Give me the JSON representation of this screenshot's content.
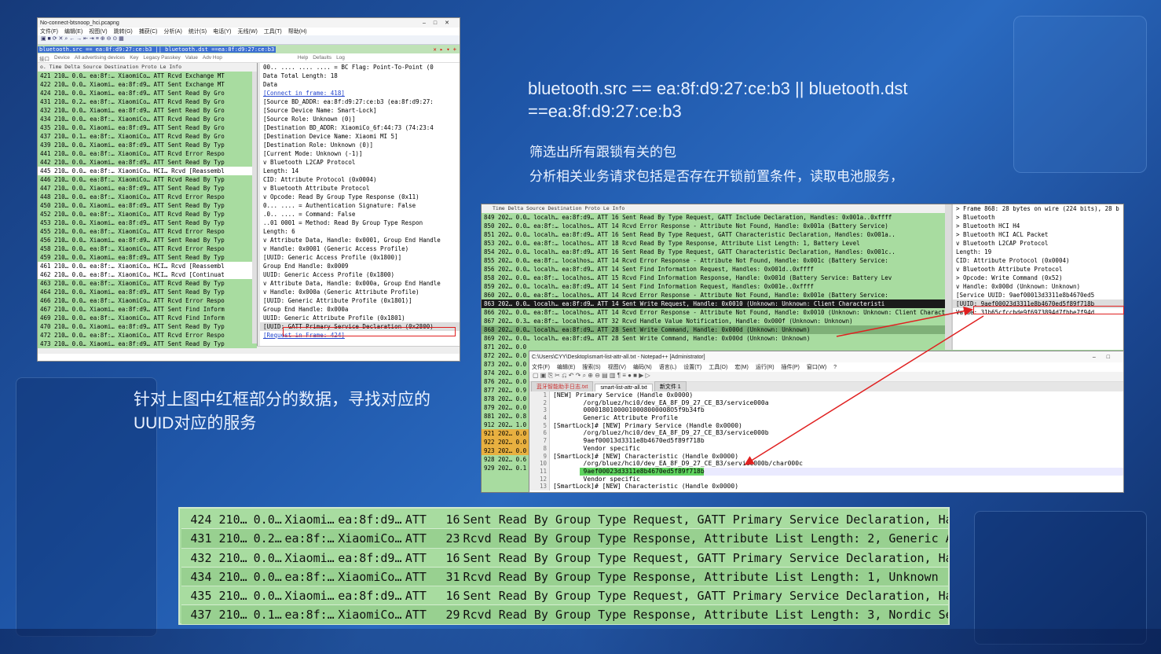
{
  "ws1": {
    "title": "No-connect-btsnoop_hci.pcapng",
    "menu": [
      "文件(F)",
      "编辑(E)",
      "视图(V)",
      "跳转(G)",
      "捕获(C)",
      "分析(A)",
      "统计(S)",
      "电话(Y)",
      "无线(W)",
      "工具(T)",
      "帮助(H)"
    ],
    "filter": "bluetooth.src == ea:8f:d9:27:ce:b3 || bluetooth.dst ==ea:8f:d9:27:ce:b3",
    "bar2": [
      "接口",
      "Device",
      "All advertising devices",
      "Key",
      "Legacy Passkey",
      "Value",
      "Adv Hop",
      "Help",
      "Defaults",
      "Log"
    ],
    "header": "o.    Time  Delta  Source     Destination  Proto Le Info",
    "rows": [
      {
        "t": " 421 210… 0.0… ea:8f:… XiaomiCo… ATT   Rcvd Exchange MT",
        "c": "g"
      },
      {
        "t": " 422 210… 0.0… Xiaomi… ea:8f:d9… ATT   Sent Exchange MT",
        "c": "g"
      },
      {
        "t": " 424 210… 0.0… Xiaomi… ea:8f:d9… ATT   Sent Read By Gro",
        "c": "g"
      },
      {
        "t": " 431 210… 0.2… ea:8f:… XiaomiCo… ATT   Rcvd Read By Gro",
        "c": "g"
      },
      {
        "t": " 432 210… 0.0… Xiaomi… ea:8f:d9… ATT   Sent Read By Gro",
        "c": "g"
      },
      {
        "t": " 434 210… 0.0… ea:8f:… XiaomiCo… ATT   Rcvd Read By Gro",
        "c": "g"
      },
      {
        "t": " 435 210… 0.0… Xiaomi… ea:8f:d9… ATT   Sent Read By Gro",
        "c": "g"
      },
      {
        "t": " 437 210… 0.1… ea:8f:… XiaomiCo… ATT   Rcvd Read By Gro",
        "c": "g"
      },
      {
        "t": " 439 210… 0.0… Xiaomi… ea:8f:d9… ATT   Sent Read By Typ",
        "c": "g"
      },
      {
        "t": " 441 210… 0.0… ea:8f:… XiaomiCo… ATT   Rcvd Error Respo",
        "c": "g"
      },
      {
        "t": " 442 210… 0.0… Xiaomi… ea:8f:d9… ATT   Sent Read By Typ",
        "c": "g"
      },
      {
        "t": " 445 210… 0.0… ea:8f:… XiaomiCo… HCI…  Rcvd [Reassembl",
        "c": "w"
      },
      {
        "t": " 446 210… 0.0… ea:8f:… XiaomiCo… ATT   Rcvd Read By Typ",
        "c": "g"
      },
      {
        "t": " 447 210… 0.0… Xiaomi… ea:8f:d9… ATT   Sent Read By Typ",
        "c": "g"
      },
      {
        "t": " 448 210… 0.0… ea:8f:… XiaomiCo… ATT   Rcvd Error Respo",
        "c": "g"
      },
      {
        "t": " 450 210… 0.0… Xiaomi… ea:8f:d9… ATT   Sent Read By Typ",
        "c": "g"
      },
      {
        "t": " 452 210… 0.0… ea:8f:… XiaomiCo… ATT   Rcvd Read By Typ",
        "c": "g"
      },
      {
        "t": " 453 210… 0.0… Xiaomi… ea:8f:d9… ATT   Sent Read By Typ",
        "c": "g"
      },
      {
        "t": " 455 210… 0.0… ea:8f:… XiaomiCo… ATT   Rcvd Error Respo",
        "c": "g"
      },
      {
        "t": " 456 210… 0.0… Xiaomi… ea:8f:d9… ATT   Sent Read By Typ",
        "c": "g"
      },
      {
        "t": " 458 210… 0.0… ea:8f:… XiaomiCo… ATT   Rcvd Error Respo",
        "c": "g"
      },
      {
        "t": " 459 210… 0.0… Xiaomi… ea:8f:d9… ATT   Sent Read By Typ",
        "c": "g"
      },
      {
        "t": " 461 210… 0.0… ea:8f:… XiaomiCo… HCI…  Rcvd [Reassembl",
        "c": "w"
      },
      {
        "t": " 462 210… 0.0… ea:8f:… XiaomiCo… HCI…  Rcvd [Continuat",
        "c": "w"
      },
      {
        "t": " 463 210… 0.0… ea:8f:… XiaomiCo… ATT   Rcvd Read By Typ",
        "c": "g"
      },
      {
        "t": " 464 210… 0.0… Xiaomi… ea:8f:d9… ATT   Sent Read By Typ",
        "c": "g"
      },
      {
        "t": " 466 210… 0.0… ea:8f:… XiaomiCo… ATT   Rcvd Error Respo",
        "c": "g"
      },
      {
        "t": " 467 210… 0.0… Xiaomi… ea:8f:d9… ATT   Sent Find Inform",
        "c": "g"
      },
      {
        "t": " 469 210… 0.0… ea:8f:… XiaomiCo… ATT   Rcvd Find Inform",
        "c": "g"
      },
      {
        "t": " 470 210… 0.0… Xiaomi… ea:8f:d9… ATT   Sent Read By Typ",
        "c": "g"
      },
      {
        "t": " 472 210… 0.0… ea:8f:… XiaomiCo… ATT   Rcvd Error Respo",
        "c": "g"
      },
      {
        "t": " 473 210… 0.0… Xiaomi… ea:8f:d9… ATT   Sent Read By Typ",
        "c": "g"
      }
    ],
    "detail": [
      {
        "t": "      00.. .... .... .... = BC Flag: Point-To-Point (0",
        "c": ""
      },
      {
        "t": "    Data Total Length: 18",
        "c": ""
      },
      {
        "t": "    Data",
        "c": ""
      },
      {
        "t": "    [Connect in frame: 418]",
        "c": "lnk"
      },
      {
        "t": "    [Source BD_ADDR: ea:8f:d9:27:ce:b3 (ea:8f:d9:27:",
        "c": ""
      },
      {
        "t": "    [Source Device Name: Smart-Lock]",
        "c": ""
      },
      {
        "t": "    [Source Role: Unknown (0)]",
        "c": ""
      },
      {
        "t": "    [Destination BD_ADDR: XiaomiCo_6f:44:73 (74:23:4",
        "c": ""
      },
      {
        "t": "    [Destination Device Name: Xiaomi MI 5]",
        "c": ""
      },
      {
        "t": "    [Destination Role: Unknown (0)]",
        "c": ""
      },
      {
        "t": "    [Current Mode: Unknown (-1)]",
        "c": ""
      },
      {
        "t": "v Bluetooth L2CAP Protocol",
        "c": ""
      },
      {
        "t": "    Length: 14",
        "c": ""
      },
      {
        "t": "    CID: Attribute Protocol (0x0004)",
        "c": ""
      },
      {
        "t": "v Bluetooth Attribute Protocol",
        "c": ""
      },
      {
        "t": "  v Opcode: Read By Group Type Response (0x11)",
        "c": ""
      },
      {
        "t": "      0... .... = Authentication Signature: False",
        "c": ""
      },
      {
        "t": "      .0.. .... = Command: False",
        "c": ""
      },
      {
        "t": "      ..01 0001 = Method: Read By Group Type Respon",
        "c": ""
      },
      {
        "t": "    Length: 6",
        "c": ""
      },
      {
        "t": "  v Attribute Data, Handle: 0x0001, Group End Handle",
        "c": ""
      },
      {
        "t": "    v Handle: 0x0001 (Generic Access Profile)",
        "c": ""
      },
      {
        "t": "        [UUID: Generic Access Profile (0x1800)]",
        "c": ""
      },
      {
        "t": "      Group End Handle: 0x0009",
        "c": ""
      },
      {
        "t": "      UUID: Generic Access Profile (0x1800)",
        "c": ""
      },
      {
        "t": "  v Attribute Data, Handle: 0x000a, Group End Handle",
        "c": ""
      },
      {
        "t": "    v Handle: 0x000a (Generic Attribute Profile)",
        "c": ""
      },
      {
        "t": "        [UUID: Generic Attribute Profile (0x1801)]",
        "c": ""
      },
      {
        "t": "      Group End Handle: 0x000a",
        "c": ""
      },
      {
        "t": "      UUID: Generic Attribute Profile (0x1801)",
        "c": ""
      },
      {
        "t": "    [UUID: GATT Primary Service Declaration (0x2800)",
        "c": "box"
      },
      {
        "t": "    [Request in Frame: 424]",
        "c": "lnk"
      }
    ]
  },
  "filter_text": "bluetooth.src == ea:8f:d9:27:ce:b3 || bluetooth.dst ==ea:8f:d9:27:ce:b3",
  "desc1": "筛选出所有跟锁有关的包",
  "desc2": "分析相关业务请求包括是否存在开锁前置条件，读取电池服务，",
  "note": "针对上图中红框部分的数据，寻找对应的UUID对应的服务",
  "ws2": {
    "header": "   Time  Delta  Source    Destination  Proto  Le Info",
    "rows": [
      {
        "t": "849 202… 0.0… localh… ea:8f:d9… ATT   16 Sent Read By Type Request, GATT Include Declaration, Handles: 0x001a..0xffff",
        "c": "g"
      },
      {
        "t": "850 202… 0.0… ea:8f:… localhos… ATT   14 Rcvd Error Response - Attribute Not Found, Handle: 0x001a (Battery Service)",
        "c": "g"
      },
      {
        "t": "851 202… 0.0… localh… ea:8f:d9… ATT   16 Sent Read By Type Request, GATT Characteristic Declaration, Handles: 0x001a..",
        "c": "g"
      },
      {
        "t": "853 202… 0.0… ea:8f:… localhos… ATT   18 Rcvd Read By Type Response, Attribute List Length: 1, Battery Level",
        "c": "g"
      },
      {
        "t": "854 202… 0.0… localh… ea:8f:d9… ATT   16 Sent Read By Type Request, GATT Characteristic Declaration, Handles: 0x001c..",
        "c": "g"
      },
      {
        "t": "855 202… 0.0… ea:8f:… localhos… ATT   14 Rcvd Error Response - Attribute Not Found, Handle: 0x001c (Battery Service:",
        "c": "g"
      },
      {
        "t": "856 202… 0.0… localh… ea:8f:d9… ATT   14 Sent Find Information Request, Handles: 0x001d..0xffff",
        "c": "g"
      },
      {
        "t": "858 202… 0.0… ea:8f:… localhos… ATT   15 Rcvd Find Information Response, Handle: 0x001d (Battery Service: Battery Lev",
        "c": "g"
      },
      {
        "t": "859 202… 0.0… localh… ea:8f:d9… ATT   14 Sent Find Information Request, Handles: 0x001e..0xffff",
        "c": "g"
      },
      {
        "t": "860 202… 0.0… ea:8f:… localhos… ATT   14 Rcvd Error Response - Attribute Not Found, Handle: 0x001e (Battery Service:",
        "c": "g"
      },
      {
        "t": "863 202… 0.0… localh… ea:8f:d9… ATT   14 Sent Write Request, Handle: 0x0010 (Unknown: Unknown: Client Characteristi",
        "c": "sel"
      },
      {
        "t": "866 202… 0.0… ea:8f:… localhos… ATT   14 Rcvd Error Response - Attribute Not Found, Handle: 0x0010 (Unknown: Unknown: Client Characteristi",
        "c": "g"
      },
      {
        "t": "867 202… 0.3… ea:8f:… localhos… ATT   32 Rcvd Handle Value Notification, Handle: 0x000f (Unknown: Unknown)",
        "c": "g"
      },
      {
        "t": "868 202… 0.0… localh… ea:8f:d9… ATT   28 Sent Write Command, Handle: 0x000d (Unknown: Unknown)",
        "c": "hl"
      },
      {
        "t": "869 202… 0.0… localh… ea:8f:d9… ATT   28 Sent Write Command, Handle: 0x000d (Unknown: Unknown)",
        "c": "g"
      }
    ],
    "stubs": [
      "871 202… 0.0",
      "872 202… 0.0",
      "873 202… 0.0",
      "874 202… 0.0",
      "876 202… 0.0",
      "877 202… 0.9",
      "878 202… 0.0",
      "879 202… 0.0",
      "881 202… 0.8",
      "912 202… 1.0",
      "921 202… 0.0",
      "922 202… 0.0",
      "923 202… 0.0",
      "928 202… 0.6",
      "929 202… 0.1"
    ],
    "detail": [
      {
        "t": "> Frame 868: 28 bytes on wire (224 bits), 28 b",
        "c": ""
      },
      {
        "t": "> Bluetooth",
        "c": ""
      },
      {
        "t": "> Bluetooth HCI H4",
        "c": ""
      },
      {
        "t": "> Bluetooth HCI ACL Packet",
        "c": ""
      },
      {
        "t": "v Bluetooth L2CAP Protocol",
        "c": ""
      },
      {
        "t": "    Length: 19",
        "c": ""
      },
      {
        "t": "    CID: Attribute Protocol (0x0004)",
        "c": ""
      },
      {
        "t": "v Bluetooth Attribute Protocol",
        "c": ""
      },
      {
        "t": "  > Opcode: Write Command (0x52)",
        "c": ""
      },
      {
        "t": "  v Handle: 0x000d (Unknown: Unknown)",
        "c": ""
      },
      {
        "t": "      [Service UUID: 9aef00013d3311e8b4670ed5",
        "c": ""
      },
      {
        "t": "      [UUID: 9aef00023d3311e8b4670ed5f89f718b",
        "c": "box"
      },
      {
        "t": "    Value: 31b65cfccbde9f6973894d7fbbe7f94d",
        "c": ""
      }
    ]
  },
  "npp": {
    "title": "C:\\Users\\CYY\\Desktop\\smart-list-attr-all.txt - Notepad++ [Administrator]",
    "menu": [
      "文件(F)",
      "编辑(E)",
      "搜索(S)",
      "视图(V)",
      "编码(N)",
      "语言(L)",
      "设置(T)",
      "工具(O)",
      "宏(M)",
      "运行(R)",
      "插件(P)",
      "窗口(W)",
      "?"
    ],
    "tabs": [
      "蓝牙智能助手日志.txt",
      "smart-list-attr-all.txt",
      "新文件 1"
    ],
    "lines": [
      {
        "n": "1",
        "t": "[NEW] Primary Service (Handle 0x0000)",
        "c": ""
      },
      {
        "n": "2",
        "t": "        /org/bluez/hci0/dev_EA_8F_D9_27_CE_B3/service000a",
        "c": ""
      },
      {
        "n": "3",
        "t": "        00001801000010008000008O5f9b34fb",
        "c": ""
      },
      {
        "n": "4",
        "t": "        Generic Attribute Profile",
        "c": ""
      },
      {
        "n": "5",
        "t": "[SmartLock]# [NEW] Primary Service (Handle 0x0000)",
        "c": ""
      },
      {
        "n": "6",
        "t": "        /org/bluez/hci0/dev_EA_8F_D9_27_CE_B3/service000b",
        "c": ""
      },
      {
        "n": "7",
        "t": "        9aef00013d3311e8b4670ed5f89f718b",
        "c": ""
      },
      {
        "n": "8",
        "t": "        Vendor specific",
        "c": ""
      },
      {
        "n": "9",
        "t": "[SmartLock]# [NEW] Characteristic (Handle 0x0000)",
        "c": ""
      },
      {
        "n": "10",
        "t": "        /org/bluez/hci0/dev_EA_8F_D9_27_CE_B3/service000b/char000c",
        "c": ""
      },
      {
        "n": "11",
        "t": "        9aef00023d3311e8b4670ed5f89f718b",
        "c": "hl"
      },
      {
        "n": "12",
        "t": "        Vendor specific",
        "c": ""
      },
      {
        "n": "13",
        "t": "[SmartLock]# [NEW] Characteristic (Handle 0x0000)",
        "c": ""
      }
    ]
  },
  "zoom": [
    {
      "no": "424 210…",
      "d": "0.0…",
      "s": "Xiaomi…",
      "dst": "ea:8f:d9…",
      "p": "ATT",
      "l": "16",
      "i": "Sent Read By Group Type Request, GATT Primary Service Declaration, Ha…",
      "c": "#a8dca0"
    },
    {
      "no": "431 210…",
      "d": "0.2…",
      "s": "ea:8f:…",
      "dst": "XiaomiCo…",
      "p": "ATT",
      "l": "23",
      "i": "Rcvd Read By Group Type Response, Attribute List Length: 2, Generic A…",
      "c": "#98d090"
    },
    {
      "no": "432 210…",
      "d": "0.0…",
      "s": "Xiaomi…",
      "dst": "ea:8f:d9…",
      "p": "ATT",
      "l": "16",
      "i": "Sent Read By Group Type Request, GATT Primary Service Declaration, Ha…",
      "c": "#a8dca0"
    },
    {
      "no": "434 210…",
      "d": "0.0…",
      "s": "ea:8f:…",
      "dst": "XiaomiCo…",
      "p": "ATT",
      "l": "31",
      "i": "Rcvd Read By Group Type Response, Attribute List Length: 1, Unknown",
      "c": "#98d090"
    },
    {
      "no": "435 210…",
      "d": "0.0…",
      "s": "Xiaomi…",
      "dst": "ea:8f:d9…",
      "p": "ATT",
      "l": "16",
      "i": "Sent Read By Group Type Request, GATT Primary Service Declaration, Ha…",
      "c": "#a8dca0"
    },
    {
      "no": "437 210…",
      "d": "0.1…",
      "s": "ea:8f:…",
      "dst": "XiaomiCo…",
      "p": "ATT",
      "l": "29",
      "i": "Rcvd Read By Group Type Response, Attribute List Length: 3, Nordic Se…",
      "c": "#98d090"
    }
  ]
}
